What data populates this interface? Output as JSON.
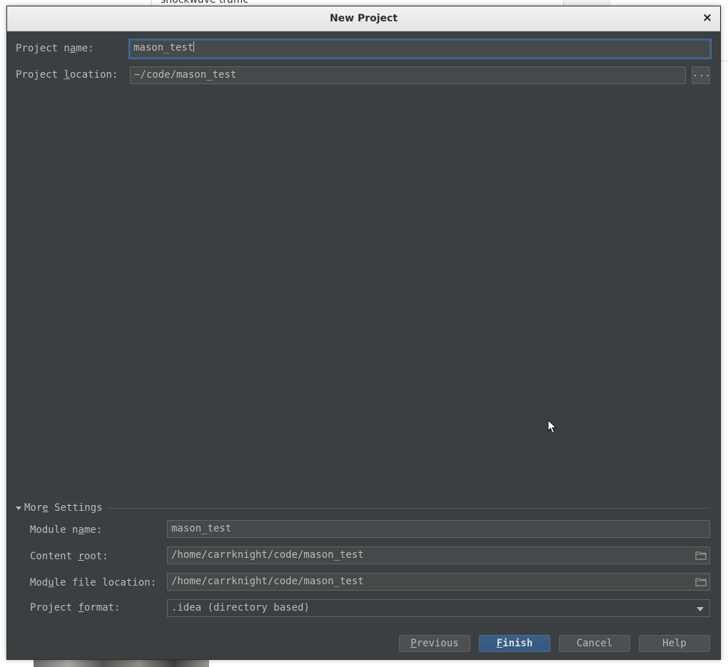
{
  "background": {
    "search_text": "shockwave traffic"
  },
  "dialog": {
    "title": "New Project",
    "close_glyph": "×"
  },
  "project_name": {
    "label_pre": "Project n",
    "label_key": "a",
    "label_post": "me:",
    "value": "mason_test"
  },
  "project_location": {
    "label_pre": "Project ",
    "label_key": "l",
    "label_post": "ocation:",
    "value": "~/code/mason_test",
    "browse_label": "..."
  },
  "more_settings": {
    "label_pre": "Mor",
    "label_key": "e",
    "label_post": " Settings",
    "module_name": {
      "label_pre": "Module n",
      "label_key": "a",
      "label_post": "me:",
      "value": "mason_test"
    },
    "content_root": {
      "label_pre": "Content ",
      "label_key": "r",
      "label_post": "oot:",
      "value": "/home/carrknight/code/mason_test",
      "icon": "folder-icon"
    },
    "module_file_location": {
      "label_pre": "Mod",
      "label_key": "u",
      "label_post": "le file location:",
      "value": "/home/carrknight/code/mason_test",
      "icon": "folder-icon"
    },
    "project_format": {
      "label_pre": "Project ",
      "label_key": "f",
      "label_post": "ormat:",
      "selected": ".idea (directory based)"
    }
  },
  "buttons": {
    "previous": {
      "key": "P",
      "rest": "revious"
    },
    "finish": {
      "key": "F",
      "rest": "inish"
    },
    "cancel": "Cancel",
    "help": "Help"
  },
  "colors": {
    "dialog_bg": "#3c3f41",
    "field_bg": "#45494a",
    "text": "#bbbbbb",
    "focus_border": "#3d6185",
    "primary_button": "#365880"
  }
}
